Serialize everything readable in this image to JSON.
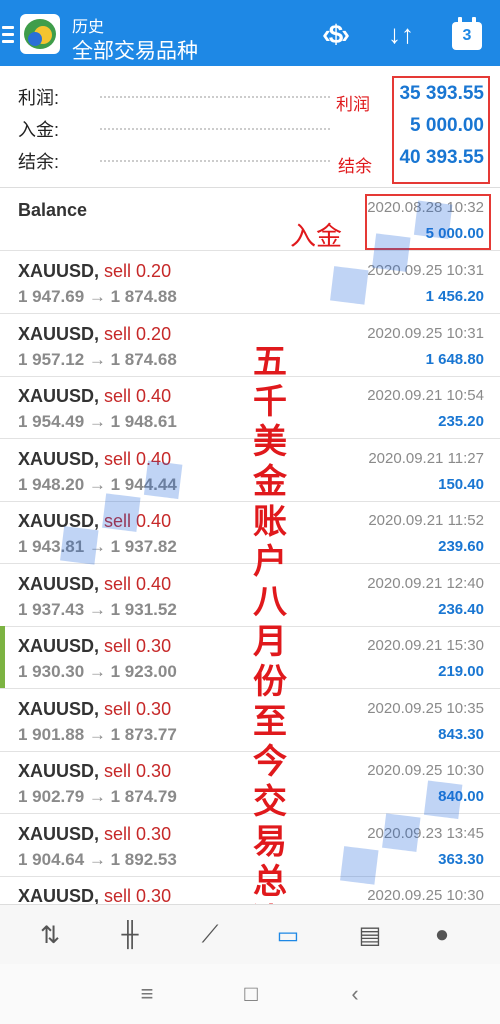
{
  "header": {
    "subtitle": "历史",
    "title": "全部交易品种",
    "calendar_day": "3"
  },
  "summary": {
    "profit_label": "利润:",
    "profit_value": "35 393.55",
    "deposit_label": "入金:",
    "deposit_value": "5 000.00",
    "balance_label": "结余:",
    "balance_value": "40 393.55"
  },
  "annotations": {
    "profit_note": "利润",
    "balance_note": "结余",
    "deposit_note": "入金",
    "vertical_note": "五千美金账户八月份至今交易总结！"
  },
  "balance_row": {
    "title": "Balance",
    "time": "2020.08.28 10:32",
    "amount": "5 000.00"
  },
  "trades": [
    {
      "symbol": "XAUUSD,",
      "side": "sell 0.20",
      "prices": "1 947.69 → 1 874.88",
      "time": "2020.09.25 10:31",
      "profit": "1 456.20"
    },
    {
      "symbol": "XAUUSD,",
      "side": "sell 0.20",
      "prices": "1 957.12 → 1 874.68",
      "time": "2020.09.25 10:31",
      "profit": "1 648.80"
    },
    {
      "symbol": "XAUUSD,",
      "side": "sell 0.40",
      "prices": "1 954.49 → 1 948.61",
      "time": "2020.09.21 10:54",
      "profit": "235.20"
    },
    {
      "symbol": "XAUUSD,",
      "side": "sell 0.40",
      "prices": "1 948.20 → 1 944.44",
      "time": "2020.09.21 11:27",
      "profit": "150.40"
    },
    {
      "symbol": "XAUUSD,",
      "side": "sell 0.40",
      "prices": "1 943.81 → 1 937.82",
      "time": "2020.09.21 11:52",
      "profit": "239.60"
    },
    {
      "symbol": "XAUUSD,",
      "side": "sell 0.40",
      "prices": "1 937.43 → 1 931.52",
      "time": "2020.09.21 12:40",
      "profit": "236.40"
    },
    {
      "symbol": "XAUUSD,",
      "side": "sell 0.30",
      "prices": "1 930.30 → 1 923.00",
      "time": "2020.09.21 15:30",
      "profit": "219.00"
    },
    {
      "symbol": "XAUUSD,",
      "side": "sell 0.30",
      "prices": "1 901.88 → 1 873.77",
      "time": "2020.09.25 10:35",
      "profit": "843.30"
    },
    {
      "symbol": "XAUUSD,",
      "side": "sell 0.30",
      "prices": "1 902.79 → 1 874.79",
      "time": "2020.09.25 10:30",
      "profit": "840.00"
    },
    {
      "symbol": "XAUUSD,",
      "side": "sell 0.30",
      "prices": "1 904.64 → 1 892.53",
      "time": "2020.09.23 13:45",
      "profit": "363.30"
    },
    {
      "symbol": "XAUUSD,",
      "side": "sell 0.30",
      "prices": "",
      "time": "2020.09.25 10:30",
      "profit": ""
    }
  ],
  "bottom_nav": [
    "quotes-icon",
    "chart-icon",
    "trade-icon",
    "history-icon",
    "news-icon",
    "chat-icon"
  ],
  "colors": {
    "accent": "#1e88e5",
    "profit": "#1976d2",
    "sell": "#c62828",
    "annotation": "#e0191c"
  }
}
